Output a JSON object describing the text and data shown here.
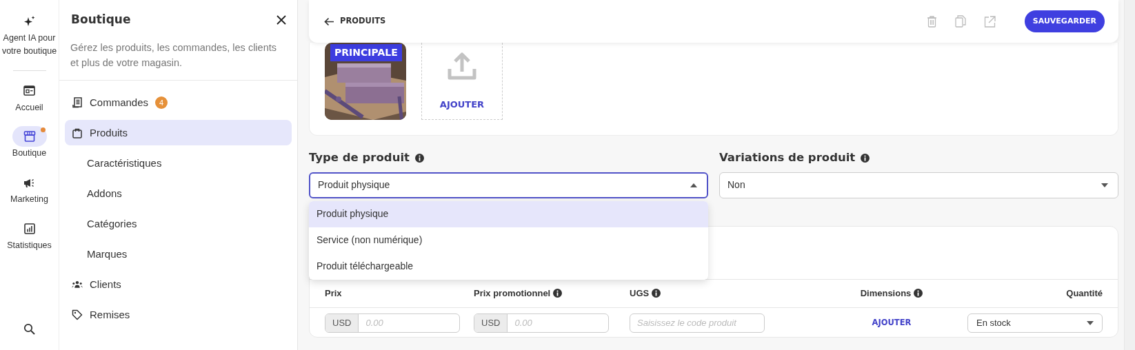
{
  "rail": {
    "items": [
      {
        "label": "Agent IA pour votre boutique",
        "selected": false,
        "notification": false
      },
      {
        "label": "Accueil",
        "selected": false,
        "notification": false
      },
      {
        "label": "Boutique",
        "selected": true,
        "notification": true
      },
      {
        "label": "Marketing",
        "selected": false,
        "notification": false
      },
      {
        "label": "Statistiques",
        "selected": false,
        "notification": false
      }
    ]
  },
  "panel": {
    "title": "Boutique",
    "description": "Gérez les produits, les commandes, les clients et plus de votre magasin.",
    "items": [
      {
        "label": "Commandes",
        "kind": "section",
        "selected": false,
        "badge": "4"
      },
      {
        "label": "Produits",
        "kind": "section",
        "selected": true
      },
      {
        "label": "Caractéristiques",
        "kind": "sub",
        "selected": false
      },
      {
        "label": "Addons",
        "kind": "sub",
        "selected": false
      },
      {
        "label": "Catégories",
        "kind": "sub",
        "selected": false
      },
      {
        "label": "Marques",
        "kind": "sub",
        "selected": false
      },
      {
        "label": "Clients",
        "kind": "section",
        "selected": false
      },
      {
        "label": "Remises",
        "kind": "section",
        "selected": false
      }
    ]
  },
  "toolbar": {
    "back_label": "PRODUITS",
    "save_label": "SAUVEGARDER"
  },
  "images": {
    "main_badge": "PRINCIPALE",
    "add_label": "AJOUTER"
  },
  "product_type": {
    "label": "Type de produit",
    "value": "Produit physique",
    "expanded": true,
    "options": [
      {
        "label": "Produit physique",
        "selected": true
      },
      {
        "label": "Service (non numérique)",
        "selected": false
      },
      {
        "label": "Produit téléchargeable",
        "selected": false
      }
    ]
  },
  "variations": {
    "label": "Variations de produit",
    "value": "Non",
    "expanded": false
  },
  "table": {
    "columns": [
      {
        "label": "Prix",
        "info": false
      },
      {
        "label": "Prix promotionnel",
        "info": true
      },
      {
        "label": "UGS",
        "info": true
      },
      {
        "label": "Dimensions",
        "info": true
      },
      {
        "label": "Quantité",
        "info": false
      }
    ],
    "row": {
      "price_currency": "USD",
      "price_placeholder": "0.00",
      "promo_currency": "USD",
      "promo_placeholder": "0.00",
      "sku_placeholder": "Saisissez le code produit",
      "dimensions_action": "AJOUTER",
      "quantity": "En stock"
    }
  }
}
